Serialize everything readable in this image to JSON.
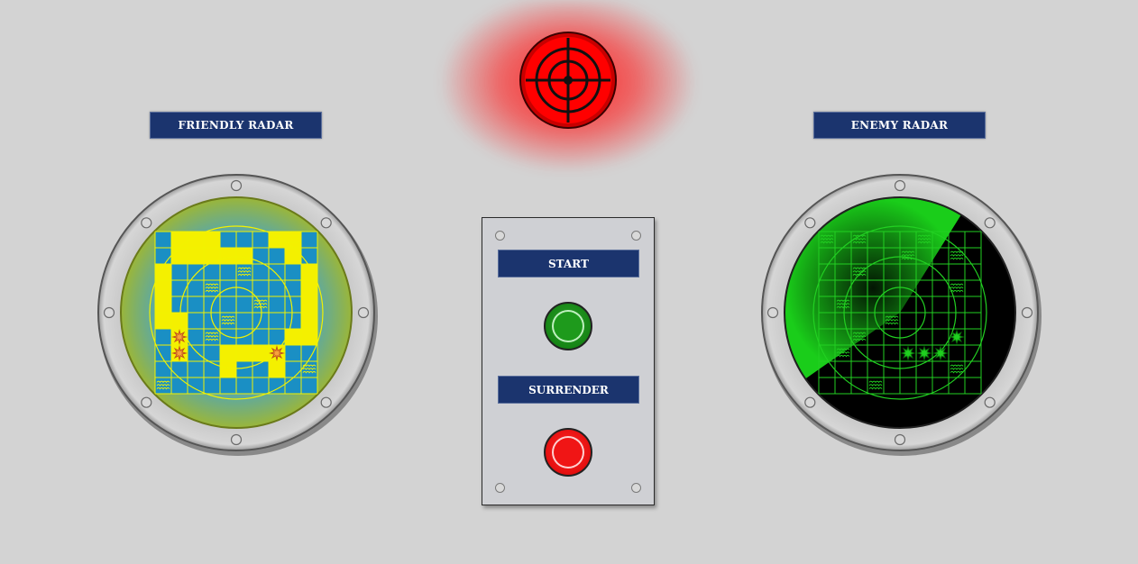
{
  "labels": {
    "friendly_radar": "FRIENDLY RADAR",
    "enemy_radar": "ENEMY RADAR",
    "start": "START",
    "surrender": "SURRENDER"
  },
  "colors": {
    "label_bg": "#1b346e",
    "friendly_grid": "#f2f200",
    "friendly_water": "#1a8fc4",
    "friendly_ship": "#f4f000",
    "enemy_grid": "#22d022",
    "alarm": "#ff1a1a",
    "start_button": "#168515",
    "surrender_button": "#e50f0f"
  },
  "icons": {
    "friendly_hit": "explosion-icon",
    "enemy_hit": "burst-icon",
    "miss": "wave-icon",
    "alarm": "crosshair-icon"
  },
  "friendly_board": {
    "grid_size": 10,
    "ships": [
      [
        0,
        1
      ],
      [
        0,
        2
      ],
      [
        0,
        3
      ],
      [
        1,
        1
      ],
      [
        1,
        2
      ],
      [
        1,
        3
      ],
      [
        1,
        4
      ],
      [
        1,
        5
      ],
      [
        0,
        7
      ],
      [
        0,
        8
      ],
      [
        1,
        8
      ],
      [
        2,
        9
      ],
      [
        3,
        9
      ],
      [
        4,
        9
      ],
      [
        5,
        9
      ],
      [
        2,
        0
      ],
      [
        3,
        0
      ],
      [
        4,
        0
      ],
      [
        5,
        0
      ],
      [
        5,
        1
      ],
      [
        6,
        1
      ],
      [
        7,
        1
      ],
      [
        7,
        4
      ],
      [
        8,
        4
      ],
      [
        7,
        5
      ],
      [
        7,
        6
      ],
      [
        7,
        7
      ],
      [
        8,
        7
      ],
      [
        6,
        8
      ],
      [
        6,
        9
      ]
    ],
    "hits": [
      [
        6,
        1
      ],
      [
        7,
        1
      ],
      [
        7,
        7
      ]
    ],
    "misses": [
      [
        0,
        7
      ],
      [
        0,
        8
      ],
      [
        3,
        3
      ],
      [
        6,
        3
      ],
      [
        9,
        0
      ],
      [
        8,
        9
      ],
      [
        2,
        5
      ],
      [
        5,
        4
      ],
      [
        4,
        6
      ]
    ]
  },
  "enemy_board": {
    "grid_size": 10,
    "hits": [
      [
        7,
        5
      ],
      [
        7,
        6
      ],
      [
        7,
        7
      ],
      [
        6,
        8
      ]
    ],
    "misses": [
      [
        0,
        0
      ],
      [
        0,
        2
      ],
      [
        0,
        6
      ],
      [
        1,
        5
      ],
      [
        1,
        8
      ],
      [
        2,
        2
      ],
      [
        3,
        8
      ],
      [
        4,
        1
      ],
      [
        5,
        4
      ],
      [
        6,
        2
      ],
      [
        7,
        1
      ],
      [
        8,
        8
      ],
      [
        9,
        3
      ]
    ]
  }
}
